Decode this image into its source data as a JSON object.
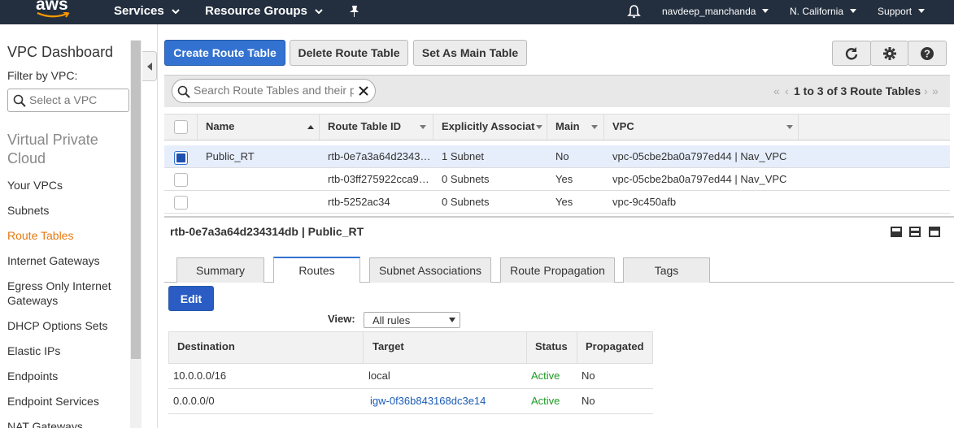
{
  "nav": {
    "logo": "aws",
    "services": "Services",
    "resource_groups": "Resource Groups",
    "user": "navdeep_manchanda",
    "region": "N. California",
    "support": "Support"
  },
  "sidebar": {
    "title": "VPC Dashboard",
    "filter_label": "Filter by VPC:",
    "filter_placeholder": "Select a VPC",
    "section": "Virtual Private Cloud",
    "items": [
      {
        "label": "Your VPCs"
      },
      {
        "label": "Subnets"
      },
      {
        "label": "Route Tables"
      },
      {
        "label": "Internet Gateways"
      },
      {
        "label": "Egress Only Internet Gateways"
      },
      {
        "label": "DHCP Options Sets"
      },
      {
        "label": "Elastic IPs"
      },
      {
        "label": "Endpoints"
      },
      {
        "label": "Endpoint Services"
      },
      {
        "label": "NAT Gateways"
      }
    ]
  },
  "toolbar": {
    "create": "Create Route Table",
    "delete": "Delete Route Table",
    "set_main": "Set As Main Table"
  },
  "search": {
    "placeholder": "Search Route Tables and their properties"
  },
  "pager": {
    "text": "1 to 3 of 3 Route Tables"
  },
  "table": {
    "columns": [
      "Name",
      "Route Table ID",
      "Explicitly Associat",
      "Main",
      "VPC"
    ],
    "rows": [
      {
        "name": "Public_RT",
        "id": "rtb-0e7a3a64d2343…",
        "assoc": "1 Subnet",
        "main": "No",
        "vpc": "vpc-05cbe2ba0a797ed44 | Nav_VPC",
        "selected": true
      },
      {
        "name": "",
        "id": "rtb-03ff275922cca9…",
        "assoc": "0 Subnets",
        "main": "Yes",
        "vpc": "vpc-05cbe2ba0a797ed44 | Nav_VPC",
        "selected": false
      },
      {
        "name": "",
        "id": "rtb-5252ac34",
        "assoc": "0 Subnets",
        "main": "Yes",
        "vpc": "vpc-9c450afb",
        "selected": false
      }
    ]
  },
  "detail": {
    "title": "rtb-0e7a3a64d234314db | Public_RT",
    "tabs": [
      "Summary",
      "Routes",
      "Subnet Associations",
      "Route Propagation",
      "Tags"
    ],
    "active_tab": "Routes",
    "edit": "Edit",
    "view_label": "View:",
    "view_value": "All rules",
    "routes_columns": [
      "Destination",
      "Target",
      "Status",
      "Propagated"
    ],
    "routes": [
      {
        "destination": "10.0.0.0/16",
        "target": "local",
        "status": "Active",
        "propagated": "No"
      },
      {
        "destination": "0.0.0.0/0",
        "target": "igw-0f36b843168dc3e14",
        "status": "Active",
        "propagated": "No"
      }
    ]
  },
  "colors": {
    "nav_bg": "#232f3e",
    "primary": "#3372d0",
    "active_link": "#e47911",
    "status_active": "#1d9a24"
  }
}
